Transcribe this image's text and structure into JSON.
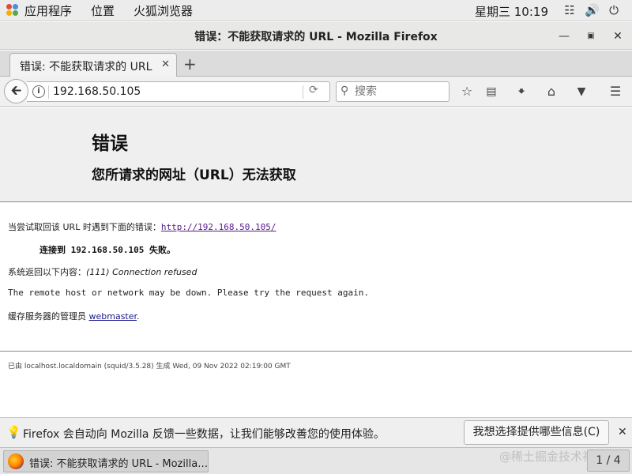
{
  "topbar": {
    "applications": "应用程序",
    "places": "位置",
    "browser_app": "火狐浏览器",
    "clock": "星期三 10:19"
  },
  "window": {
    "title": "错误：不能获取请求的  URL - Mozilla Firefox"
  },
  "tabs": [
    {
      "label": "错误: 不能获取请求的 URL"
    }
  ],
  "navbar": {
    "url": "192.168.50.105",
    "search_placeholder": "搜索"
  },
  "page": {
    "heading": "错误",
    "subheading": "您所请求的网址（URL）无法获取",
    "attempt_prefix": "当尝试取回该 URL 时遇到下面的错误：",
    "attempt_link": "http://192.168.50.105/",
    "connect_failed": "连接到 192.168.50.105 失败。",
    "system_returned": "系统返回以下内容：",
    "system_message": "(111) Connection refused",
    "remote_down": "The remote host or network may be down. Please try the request again.",
    "admin_prefix": "缓存服务器的管理员 ",
    "admin_link": "webmaster",
    "admin_suffix": ".",
    "footer": "已由 localhost.localdomain (squid/3.5.28) 生成 Wed, 09 Nov 2022 02:19:00 GMT"
  },
  "notification": {
    "message": "Firefox 会自动向 Mozilla 反馈一些数据，让我们能够改善您的使用体验。",
    "choose_button": "我想选择提供哪些信息(C)"
  },
  "taskbar": {
    "task_label": "错误: 不能获取请求的 URL - Mozilla…",
    "watermark": "@稀土掘金技术社区",
    "workspace": "1 / 4"
  },
  "colors": {
    "link_visited": "#551a8b",
    "error_header_bg": "#efefef"
  }
}
